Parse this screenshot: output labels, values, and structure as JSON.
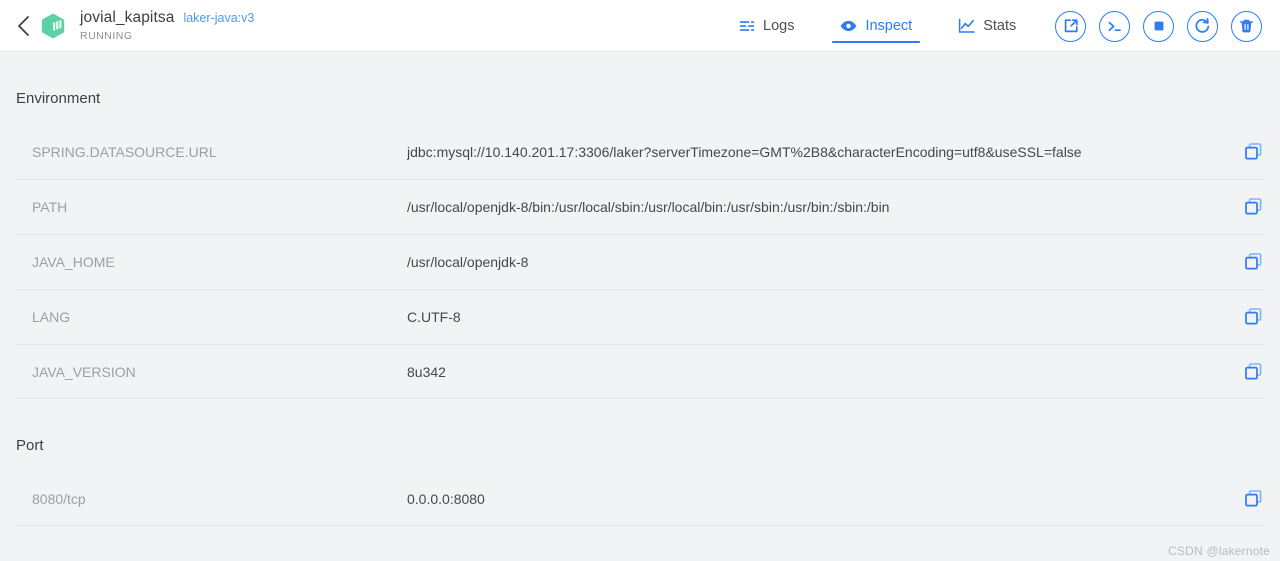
{
  "header": {
    "back_icon": "chevron-left-icon",
    "logo_icon": "container-cube-icon",
    "container_name": "jovial_kapitsa",
    "image_tag": "laker-java:v3",
    "status": "RUNNING",
    "accent_color": "#2a7df4",
    "logo_color": "#5bd1a5",
    "tabs": [
      {
        "label": "Logs",
        "icon": "logs-icon",
        "active": false
      },
      {
        "label": "Inspect",
        "icon": "eye-icon",
        "active": true
      },
      {
        "label": "Stats",
        "icon": "chart-line-icon",
        "active": false
      }
    ],
    "actions": [
      {
        "name": "open-external-button",
        "icon": "open-external-icon"
      },
      {
        "name": "terminal-button",
        "icon": "terminal-icon"
      },
      {
        "name": "stop-button",
        "icon": "stop-square-icon"
      },
      {
        "name": "restart-button",
        "icon": "restart-icon"
      },
      {
        "name": "delete-button",
        "icon": "trash-icon"
      }
    ]
  },
  "sections": [
    {
      "title": "Environment",
      "rows": [
        {
          "key": "SPRING.DATASOURCE.URL",
          "value": "jdbc:mysql://10.140.201.17:3306/laker?serverTimezone=GMT%2B8&characterEncoding=utf8&useSSL=false"
        },
        {
          "key": "PATH",
          "value": "/usr/local/openjdk-8/bin:/usr/local/sbin:/usr/local/bin:/usr/sbin:/usr/bin:/sbin:/bin"
        },
        {
          "key": "JAVA_HOME",
          "value": "/usr/local/openjdk-8"
        },
        {
          "key": "LANG",
          "value": "C.UTF-8"
        },
        {
          "key": "JAVA_VERSION",
          "value": "8u342"
        }
      ]
    },
    {
      "title": "Port",
      "rows": [
        {
          "key": "8080/tcp",
          "value": "0.0.0.0:8080"
        }
      ]
    }
  ],
  "copy_icon": "copy-icon",
  "watermark": "CSDN @lakernote"
}
